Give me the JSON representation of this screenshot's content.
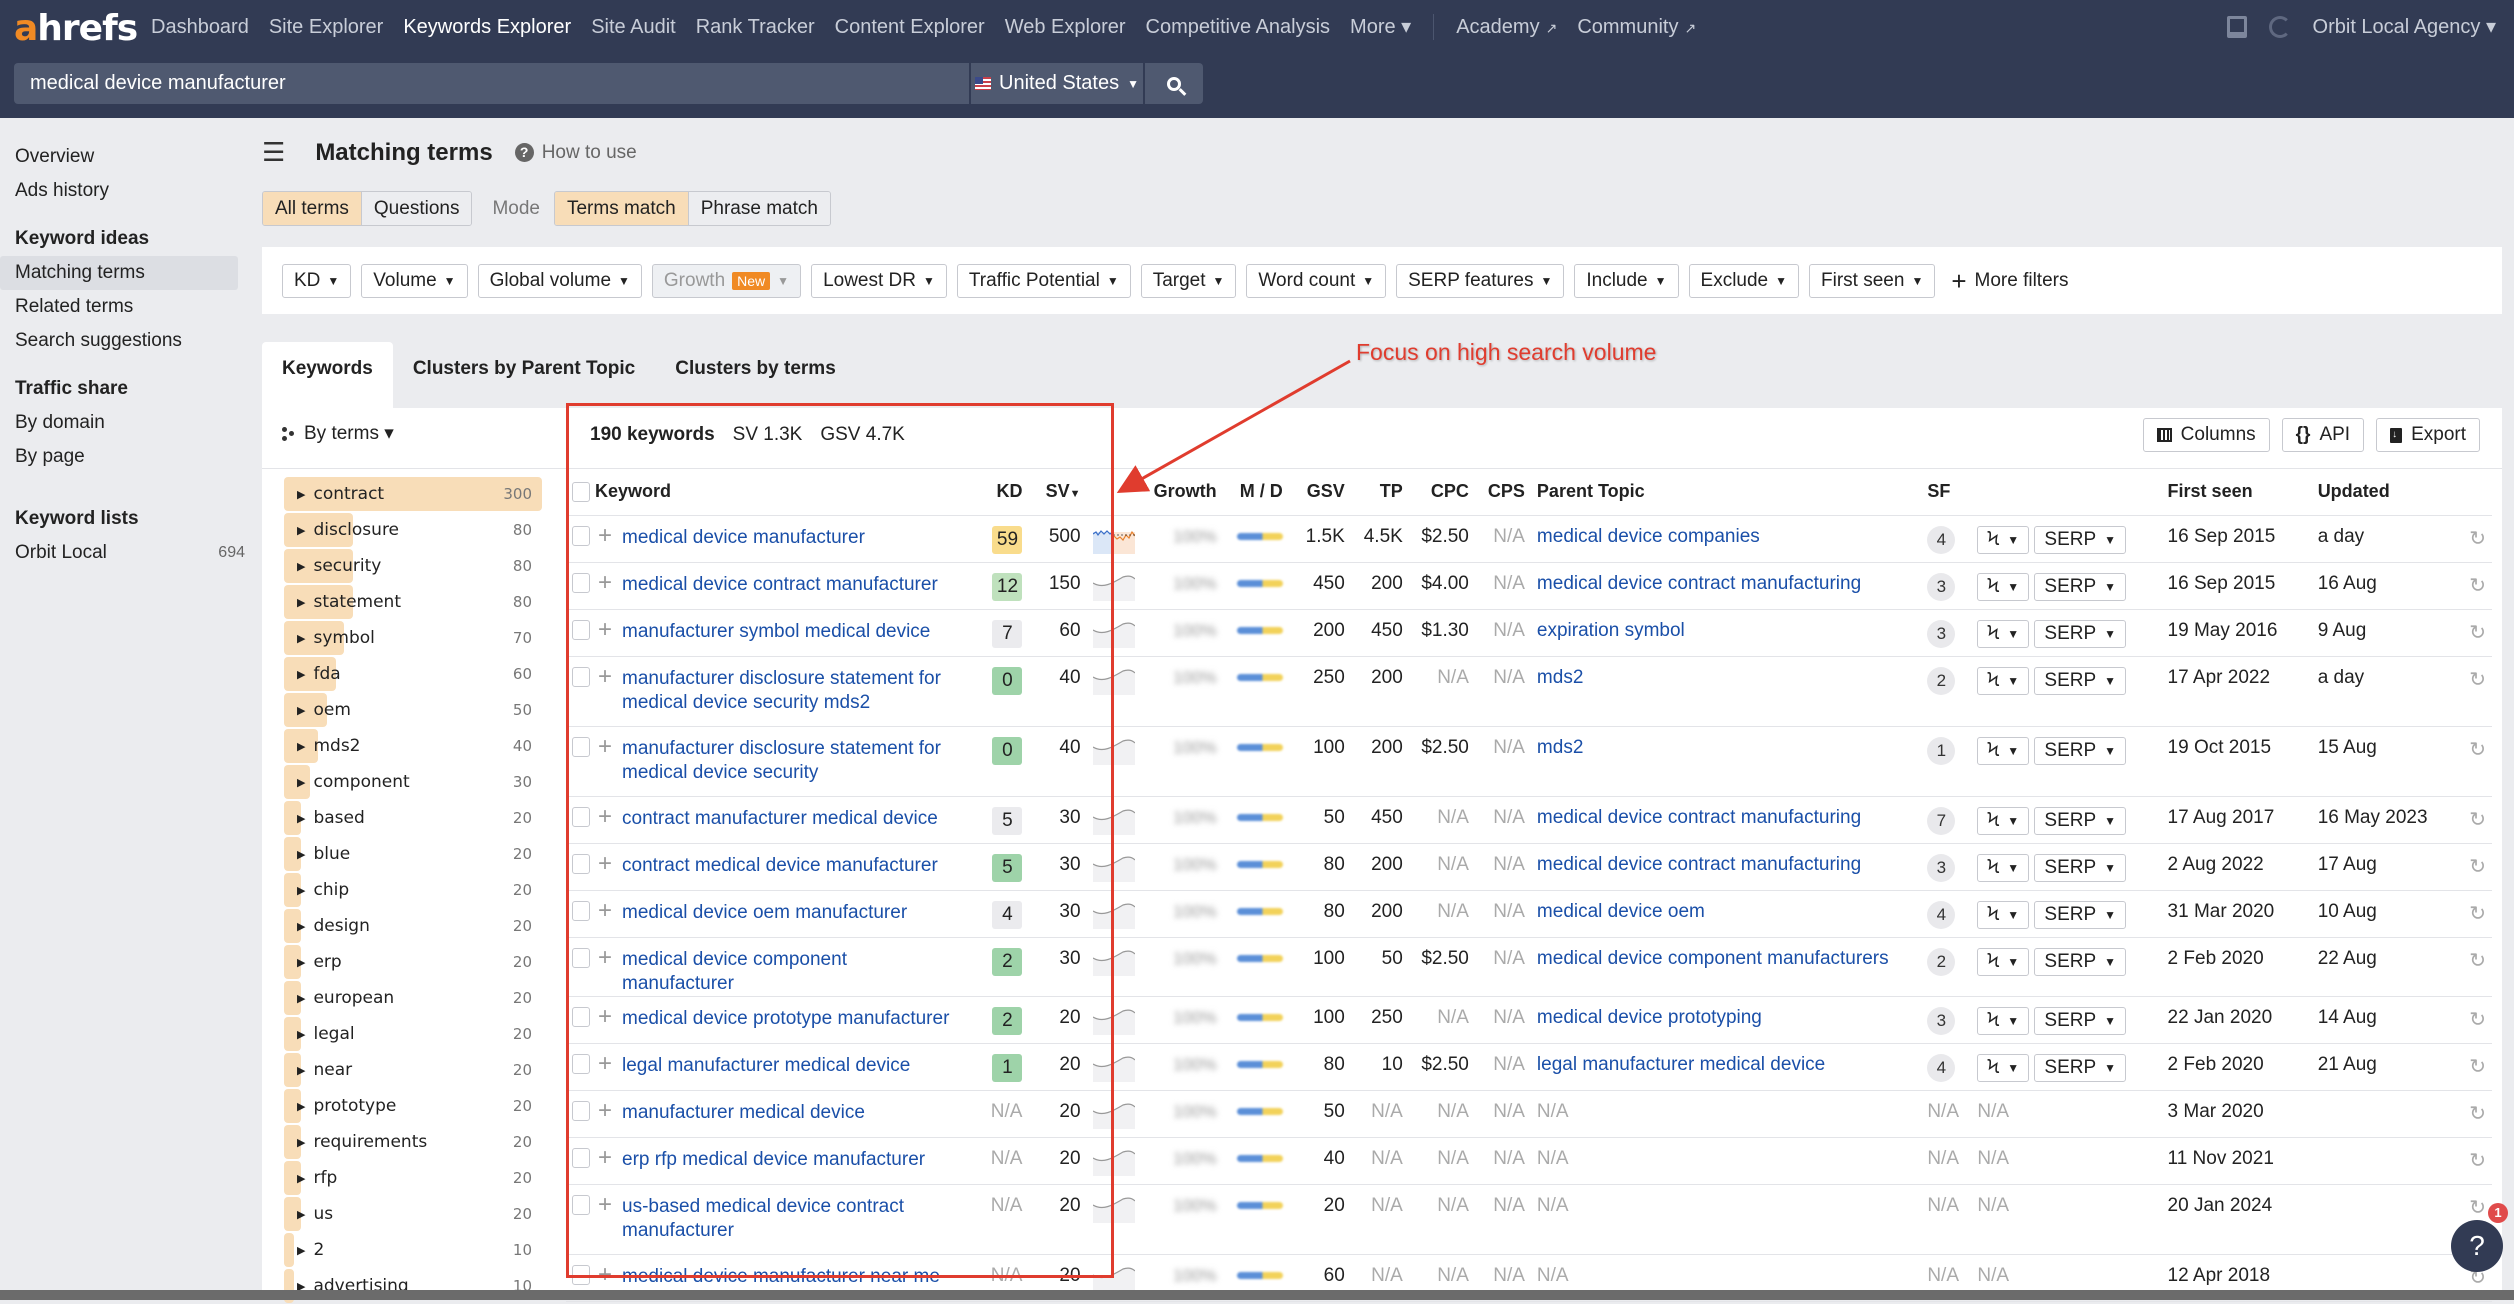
{
  "topnav": {
    "logo_a": "a",
    "logo_rest": "hrefs",
    "items": [
      {
        "label": "Dashboard",
        "active": false
      },
      {
        "label": "Site Explorer",
        "active": false
      },
      {
        "label": "Keywords Explorer",
        "active": true
      },
      {
        "label": "Site Audit",
        "active": false
      },
      {
        "label": "Rank Tracker",
        "active": false
      },
      {
        "label": "Content Explorer",
        "active": false
      },
      {
        "label": "Web Explorer",
        "active": false
      },
      {
        "label": "Competitive Analysis",
        "active": false
      },
      {
        "label": "More ▾",
        "active": false
      }
    ],
    "external": [
      {
        "label": "Academy",
        "icon": "external-link-icon"
      },
      {
        "label": "Community",
        "icon": "external-link-icon"
      }
    ],
    "account": "Orbit Local Agency ▾"
  },
  "search": {
    "query": "medical device manufacturer",
    "country": "United States"
  },
  "sidebar": {
    "top": [
      "Overview",
      "Ads history"
    ],
    "sections": [
      {
        "title": "Keyword ideas",
        "items": [
          {
            "label": "Matching terms",
            "active": true
          },
          {
            "label": "Related terms"
          },
          {
            "label": "Search suggestions"
          }
        ]
      },
      {
        "title": "Traffic share",
        "items": [
          {
            "label": "By domain"
          },
          {
            "label": "By page"
          }
        ]
      },
      {
        "title": "Keyword lists",
        "items": [
          {
            "label": "Orbit Local",
            "count": "694"
          }
        ]
      }
    ]
  },
  "page": {
    "title": "Matching terms",
    "how_to": "How to use",
    "scope_tabs": [
      {
        "label": "All terms",
        "on": true
      },
      {
        "label": "Questions",
        "on": false
      }
    ],
    "mode_label": "Mode",
    "mode_tabs": [
      {
        "label": "Terms match",
        "on": true
      },
      {
        "label": "Phrase match",
        "on": false
      }
    ]
  },
  "filters": {
    "items": [
      {
        "label": "KD"
      },
      {
        "label": "Volume"
      },
      {
        "label": "Global volume"
      },
      {
        "label": "Growth",
        "badge": "New",
        "disabled": true
      },
      {
        "label": "Lowest DR"
      },
      {
        "label": "Traffic Potential"
      },
      {
        "label": "Target"
      },
      {
        "label": "Word count"
      },
      {
        "label": "SERP features"
      },
      {
        "label": "Include"
      },
      {
        "label": "Exclude"
      },
      {
        "label": "First seen"
      }
    ],
    "more": "More filters"
  },
  "view_tabs": [
    {
      "label": "Keywords",
      "on": true
    },
    {
      "label": "Clusters by Parent Topic",
      "on": false
    },
    {
      "label": "Clusters by terms",
      "on": false
    }
  ],
  "terms_panel": {
    "group_by": "By terms ▾",
    "max": 300,
    "terms": [
      {
        "t": "contract",
        "c": 300
      },
      {
        "t": "disclosure",
        "c": 80
      },
      {
        "t": "security",
        "c": 80
      },
      {
        "t": "statement",
        "c": 80
      },
      {
        "t": "symbol",
        "c": 70
      },
      {
        "t": "fda",
        "c": 60
      },
      {
        "t": "oem",
        "c": 50
      },
      {
        "t": "mds2",
        "c": 40
      },
      {
        "t": "component",
        "c": 30
      },
      {
        "t": "based",
        "c": 20
      },
      {
        "t": "blue",
        "c": 20
      },
      {
        "t": "chip",
        "c": 20
      },
      {
        "t": "design",
        "c": 20
      },
      {
        "t": "erp",
        "c": 20
      },
      {
        "t": "european",
        "c": 20
      },
      {
        "t": "legal",
        "c": 20
      },
      {
        "t": "near",
        "c": 20
      },
      {
        "t": "prototype",
        "c": 20
      },
      {
        "t": "requirements",
        "c": 20
      },
      {
        "t": "rfp",
        "c": 20
      },
      {
        "t": "us",
        "c": 20
      },
      {
        "t": "2",
        "c": 10
      },
      {
        "t": "advertising",
        "c": 10
      }
    ]
  },
  "summary": {
    "count": "190 keywords",
    "sv": "SV 1.3K",
    "gsv": "GSV 4.7K"
  },
  "toolbar": {
    "columns": "Columns",
    "api": "API",
    "export": "Export"
  },
  "table": {
    "headers": {
      "keyword": "Keyword",
      "kd": "KD",
      "sv": "SV",
      "growth": "Growth",
      "md": "M / D",
      "gsv": "GSV",
      "tp": "TP",
      "cpc": "CPC",
      "cps": "CPS",
      "parent": "Parent Topic",
      "sf": "SF",
      "first_seen": "First seen",
      "updated": "Updated"
    },
    "growth_placeholder": "100%",
    "serp_label": "SERP",
    "rows": [
      {
        "kw": "medical device manufacturer",
        "kd": "59",
        "kdc": "#f9dc8c",
        "sv": "500",
        "gsv": "1.5K",
        "tp": "4.5K",
        "cpc": "$2.50",
        "cps": "N/A",
        "parent": "medical device companies",
        "sf": "4",
        "first": "16 Sep 2015",
        "upd": "a day",
        "trend": "multi"
      },
      {
        "kw": "medical device contract manufacturer",
        "kd": "12",
        "kdc": "#bfe1bd",
        "sv": "150",
        "gsv": "450",
        "tp": "200",
        "cpc": "$4.00",
        "cps": "N/A",
        "parent": "medical device contract manufacturing",
        "sf": "3",
        "first": "16 Sep 2015",
        "upd": "16 Aug"
      },
      {
        "kw": "manufacturer symbol medical device",
        "kd": "7",
        "kdc": "#ebebee",
        "sv": "60",
        "gsv": "200",
        "tp": "450",
        "cpc": "$1.30",
        "cps": "N/A",
        "parent": "expiration symbol",
        "sf": "3",
        "first": "19 May 2016",
        "upd": "9 Aug"
      },
      {
        "kw": "manufacturer disclosure statement for medical device security mds2",
        "kd": "0",
        "kdc": "#9ed3a9",
        "sv": "40",
        "gsv": "250",
        "tp": "200",
        "cpc": "N/A",
        "cps": "N/A",
        "parent": "mds2",
        "sf": "2",
        "first": "17 Apr 2022",
        "upd": "a day"
      },
      {
        "kw": "manufacturer disclosure statement for medical device security",
        "kd": "0",
        "kdc": "#9ed3a9",
        "sv": "40",
        "gsv": "100",
        "tp": "200",
        "cpc": "$2.50",
        "cps": "N/A",
        "parent": "mds2",
        "sf": "1",
        "first": "19 Oct 2015",
        "upd": "15 Aug"
      },
      {
        "kw": "contract manufacturer medical device",
        "kd": "5",
        "kdc": "#ebebee",
        "sv": "30",
        "gsv": "50",
        "tp": "450",
        "cpc": "N/A",
        "cps": "N/A",
        "parent": "medical device contract manufacturing",
        "sf": "7",
        "first": "17 Aug 2017",
        "upd": "16 May 2023"
      },
      {
        "kw": "contract medical device manufacturer",
        "kd": "5",
        "kdc": "#9ed3a9",
        "sv": "30",
        "gsv": "80",
        "tp": "200",
        "cpc": "N/A",
        "cps": "N/A",
        "parent": "medical device contract manufacturing",
        "sf": "3",
        "first": "2 Aug 2022",
        "upd": "17 Aug"
      },
      {
        "kw": "medical device oem manufacturer",
        "kd": "4",
        "kdc": "#ebebee",
        "sv": "30",
        "gsv": "80",
        "tp": "200",
        "cpc": "N/A",
        "cps": "N/A",
        "parent": "medical device oem",
        "sf": "4",
        "first": "31 Mar 2020",
        "upd": "10 Aug"
      },
      {
        "kw": "medical device component manufacturer",
        "kd": "2",
        "kdc": "#9ed3a9",
        "sv": "30",
        "gsv": "100",
        "tp": "50",
        "cpc": "$2.50",
        "cps": "N/A",
        "parent": "medical device component manufacturers",
        "sf": "2",
        "first": "2 Feb 2020",
        "upd": "22 Aug"
      },
      {
        "kw": "medical device prototype manufacturer",
        "kd": "2",
        "kdc": "#9ed3a9",
        "sv": "20",
        "gsv": "100",
        "tp": "250",
        "cpc": "N/A",
        "cps": "N/A",
        "parent": "medical device prototyping",
        "sf": "3",
        "first": "22 Jan 2020",
        "upd": "14 Aug"
      },
      {
        "kw": "legal manufacturer medical device",
        "kd": "1",
        "kdc": "#9ed3a9",
        "sv": "20",
        "gsv": "80",
        "tp": "10",
        "cpc": "$2.50",
        "cps": "N/A",
        "parent": "legal manufacturer medical device",
        "sf": "4",
        "first": "2 Feb 2020",
        "upd": "21 Aug"
      },
      {
        "kw": "manufacturer medical device",
        "kd": "N/A",
        "sv": "20",
        "gsv": "50",
        "tp": "N/A",
        "cpc": "N/A",
        "cps": "N/A",
        "parent": "N/A",
        "sf": "N/A",
        "first": "3 Mar 2020",
        "upd": "",
        "empty": true
      },
      {
        "kw": "erp rfp medical device manufacturer",
        "kd": "N/A",
        "sv": "20",
        "gsv": "40",
        "tp": "N/A",
        "cpc": "N/A",
        "cps": "N/A",
        "parent": "N/A",
        "sf": "N/A",
        "first": "11 Nov 2021",
        "upd": "",
        "empty": true
      },
      {
        "kw": "us-based medical device contract manufacturer",
        "kd": "N/A",
        "sv": "20",
        "gsv": "20",
        "tp": "N/A",
        "cpc": "N/A",
        "cps": "N/A",
        "parent": "N/A",
        "sf": "N/A",
        "first": "20 Jan 2024",
        "upd": "",
        "empty": true
      },
      {
        "kw": "medical device manufacturer near me",
        "kd": "N/A",
        "sv": "20",
        "gsv": "60",
        "tp": "N/A",
        "cpc": "N/A",
        "cps": "N/A",
        "parent": "N/A",
        "sf": "N/A",
        "first": "12 Apr 2018",
        "upd": "",
        "empty": true
      }
    ]
  },
  "annotation": {
    "text": "Focus on high search volume",
    "color": "#e03c2e"
  },
  "help": {
    "label": "?",
    "badge": "1"
  }
}
